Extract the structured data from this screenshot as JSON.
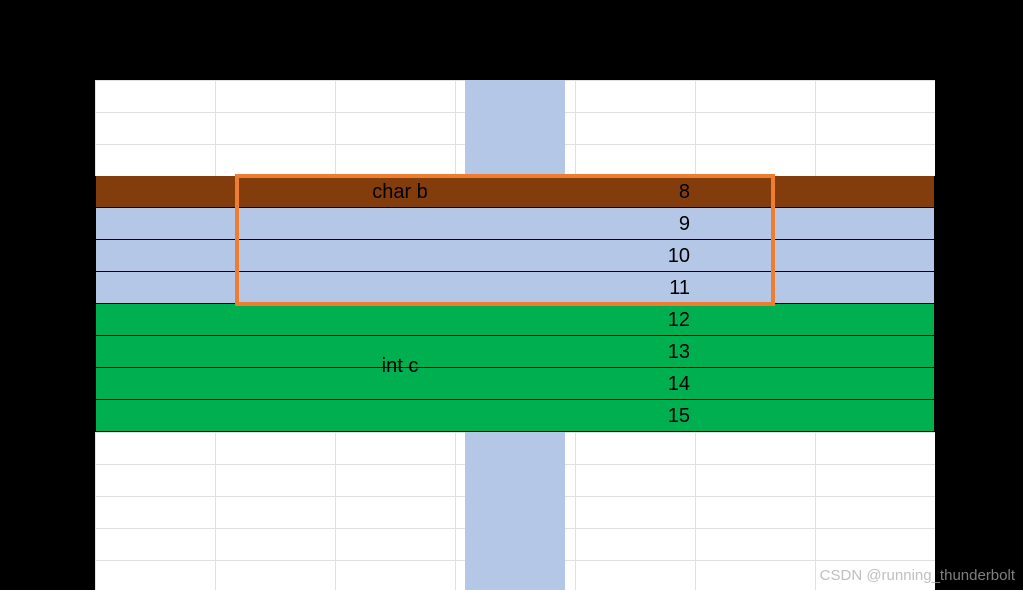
{
  "labels": {
    "char_b": "char b",
    "int_c": "int c"
  },
  "addresses": {
    "r8": "8",
    "r9": "9",
    "r10": "10",
    "r11": "11",
    "r12": "12",
    "r13": "13",
    "r14": "14",
    "r15": "15"
  },
  "watermark": "CSDN @running_thunderbolt",
  "chart_data": {
    "type": "table",
    "description": "Memory layout diagram showing struct member alignment",
    "members": [
      {
        "name": "char b",
        "offset": 8,
        "size": 1,
        "padding_after": 3,
        "color": "#833C0C"
      },
      {
        "name": "int c",
        "offset": 12,
        "size": 4,
        "padding_after": 0,
        "color": "#00B050"
      }
    ],
    "highlighted_range": {
      "start": 8,
      "end": 11,
      "border_color": "#ED7D31"
    },
    "base_color": "#B4C7E7",
    "offsets_shown": [
      8,
      9,
      10,
      11,
      12,
      13,
      14,
      15
    ]
  }
}
